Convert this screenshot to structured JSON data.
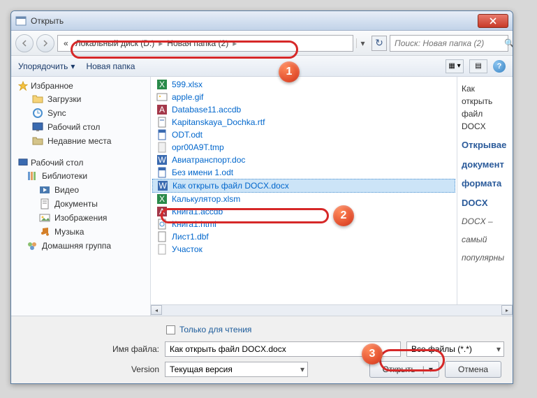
{
  "title": "Открыть",
  "breadcrumb": {
    "prefix": "«",
    "item1": "Локальный диск (D:)",
    "item2": "Новая папка (2)"
  },
  "search": {
    "placeholder": "Поиск: Новая папка (2)"
  },
  "toolbar": {
    "organize": "Упорядочить",
    "new_folder": "Новая папка"
  },
  "sidebar": {
    "favorites": "Избранное",
    "fav_items": [
      "Загрузки",
      "Sync",
      "Рабочий стол",
      "Недавние места"
    ],
    "desktop": "Рабочий стол",
    "libraries": "Библиотеки",
    "lib_items": [
      "Видео",
      "Документы",
      "Изображения",
      "Музыка"
    ],
    "homegroup": "Домашняя группа"
  },
  "files": [
    {
      "name": "599.xlsx",
      "type": "xlsx"
    },
    {
      "name": "apple.gif",
      "type": "gif"
    },
    {
      "name": "Database11.accdb",
      "type": "accdb"
    },
    {
      "name": "Kapitanskaya_Dochka.rtf",
      "type": "rtf"
    },
    {
      "name": "ODT.odt",
      "type": "odt"
    },
    {
      "name": "opr00A9T.tmp",
      "type": "tmp"
    },
    {
      "name": "Авиатранспорт.doc",
      "type": "doc"
    },
    {
      "name": "Без имени 1.odt",
      "type": "odt"
    },
    {
      "name": "Как открыть файл DOCX.docx",
      "type": "docx",
      "selected": true
    },
    {
      "name": "Калькулятор.xlsm",
      "type": "xlsx"
    },
    {
      "name": "Книга1.accdb",
      "type": "accdb"
    },
    {
      "name": "Книга1.html",
      "type": "html"
    },
    {
      "name": "Лист1.dbf",
      "type": "dbf"
    },
    {
      "name": "Участок",
      "type": "generic"
    }
  ],
  "preview": {
    "line1": "Как",
    "line2": "открыть",
    "line3": "файл",
    "line4": "DOCX",
    "h1": "Открывае",
    "h2": "документ",
    "h3": "формата",
    "h4": "DOCX",
    "em1": "DOCX –",
    "em2": "самый",
    "em3": "популярны"
  },
  "readonly_label": "Только для чтения",
  "filename_label": "Имя файла:",
  "filename_value": "Как открыть файл DOCX.docx",
  "filetype": "Все файлы (*.*)",
  "version_label": "Version",
  "version_value": "Текущая версия",
  "open_btn": "Открыть",
  "cancel_btn": "Отмена",
  "annotations": {
    "a1": "1",
    "a2": "2",
    "a3": "3"
  }
}
